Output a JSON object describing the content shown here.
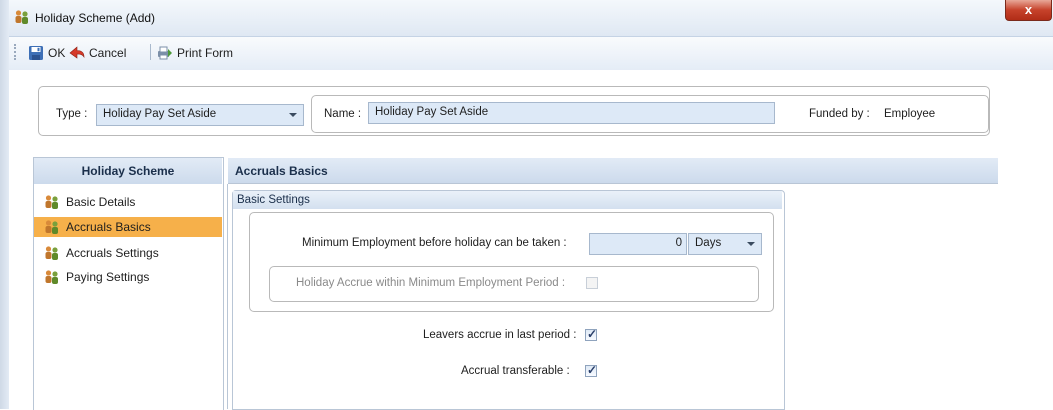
{
  "window": {
    "title": "Holiday Scheme (Add)",
    "close_label": "x"
  },
  "toolbar": {
    "ok_label": "OK",
    "cancel_label": "Cancel",
    "print_label": "Print Form"
  },
  "top": {
    "type_label": "Type :",
    "type_value": "Holiday Pay Set Aside",
    "name_label": "Name :",
    "name_value": "Holiday Pay Set Aside",
    "funded_label": "Funded by :",
    "funded_value": "Employee"
  },
  "sidebar": {
    "header": "Holiday Scheme",
    "items": [
      {
        "label": "Basic Details",
        "selected": false
      },
      {
        "label": "Accruals Basics",
        "selected": true
      },
      {
        "label": "Accruals Settings",
        "selected": false
      },
      {
        "label": "Paying Settings",
        "selected": false
      }
    ]
  },
  "main": {
    "header": "Accruals Basics",
    "group_title": "Basic Settings",
    "min_employment_label": "Minimum Employment before holiday can be taken :",
    "min_employment_value": "0",
    "min_employment_unit": "Days",
    "accrue_within_label": "Holiday Accrue within Minimum Employment Period :",
    "accrue_within_checked": false,
    "leavers_label": "Leavers accrue in last period :",
    "leavers_checked": true,
    "transferable_label": "Accrual transferable :",
    "transferable_checked": true
  },
  "colors": {
    "selected_item": "#f6b04a",
    "input_bg": "#dde9f7",
    "header_text": "#1b2f4b"
  }
}
